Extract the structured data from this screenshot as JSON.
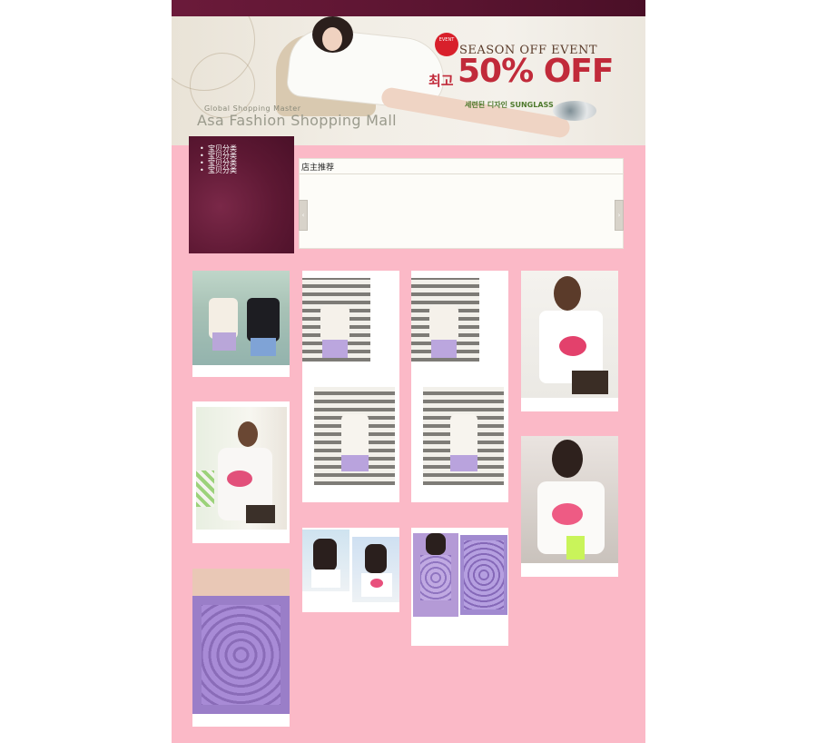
{
  "banner": {
    "brand_sub": "Global Shopping Master",
    "brand_title": "Asa Fashion Shopping Mall",
    "event_badge": "EVENT",
    "event_title": "SEASON OFF EVENT",
    "discount_prefix": "최고",
    "discount": "50% OFF",
    "sunglass_title": "세련된 디자인 SUNGLASS",
    "sunglass_desc": ""
  },
  "menu": {
    "items": [
      "宝贝分类",
      "宝贝分类",
      "宝贝分类",
      "宝贝分类"
    ]
  },
  "recommend": {
    "title": "店主推荐",
    "prev_icon": "‹",
    "next_icon": "›"
  },
  "products": {
    "caption_detail": "",
    "caption_bottom": ""
  },
  "colors": {
    "page_bg": "#fbb9c7",
    "maroon": "#5a1430",
    "discount_red": "#c12a3a"
  }
}
